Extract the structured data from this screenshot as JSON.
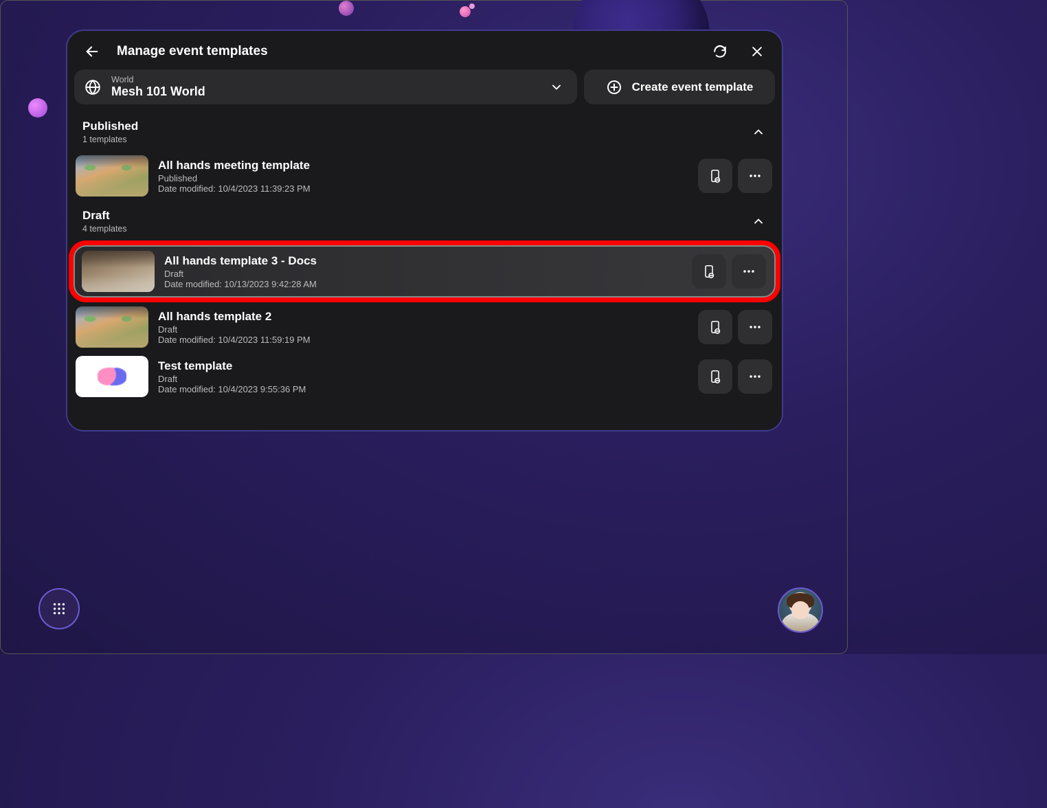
{
  "header": {
    "title": "Manage event templates"
  },
  "world": {
    "label": "World",
    "name": "Mesh 101 World"
  },
  "create_label": "Create event template",
  "sections": [
    {
      "title": "Published",
      "sub": "1 templates",
      "items": [
        {
          "name": "All hands meeting template",
          "status": "Published",
          "date": "Date modified: 10/4/2023 11:39:23 PM",
          "thumb": "scene",
          "selected": false
        }
      ]
    },
    {
      "title": "Draft",
      "sub": "4 templates",
      "items": [
        {
          "name": "All hands template 3 - Docs",
          "status": "Draft",
          "date": "Date modified: 10/13/2023 9:42:28 AM",
          "thumb": "indoor",
          "selected": true
        },
        {
          "name": "All hands template 2",
          "status": "Draft",
          "date": "Date modified: 10/4/2023 11:59:19 PM",
          "thumb": "scene",
          "selected": false
        },
        {
          "name": "Test template",
          "status": "Draft",
          "date": "Date modified: 10/4/2023 9:55:36 PM",
          "thumb": "white",
          "selected": false
        }
      ]
    }
  ]
}
